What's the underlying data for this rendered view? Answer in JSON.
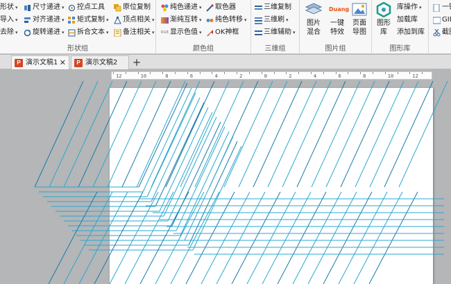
{
  "ribbon": {
    "groups": {
      "shape": {
        "label": "形状组",
        "col1": [
          "形状",
          "导入",
          "去除"
        ],
        "col2": [
          "尺寸递进",
          "对齐递进",
          "旋转递进"
        ],
        "col3": [
          "控点工具",
          "矩式复制",
          "拆合文本"
        ],
        "col4": [
          "原位复制",
          "顶点相关",
          "备注相关"
        ]
      },
      "color": {
        "label": "颜色组",
        "col1": [
          "纯色递进",
          "渐纯互转",
          "显示色值"
        ],
        "col2": [
          "取色器",
          "纯色转移",
          "OK神框"
        ]
      },
      "three_d": {
        "label": "三维组",
        "items": [
          "三维复制",
          "三维刷",
          "三维辅助"
        ]
      },
      "picture": {
        "label": "图片组",
        "big": [
          "图片混合",
          "一键特效",
          "页面导图"
        ],
        "badge": "Duang"
      },
      "shape_lib": {
        "label": "图形库",
        "big": "图形库",
        "items": [
          "库操作",
          "加载库",
          "添加到库"
        ]
      },
      "extra": {
        "items": [
          "一键",
          "GIF",
          "截图"
        ]
      }
    }
  },
  "tabs": [
    {
      "label": "演示文稿1",
      "active": true,
      "icon": "P"
    },
    {
      "label": "演示文稿2",
      "active": false,
      "icon": "P"
    }
  ],
  "ruler": {
    "labels": [
      "12",
      "10",
      "8",
      "6",
      "4",
      "2",
      "0",
      "2",
      "4",
      "6",
      "8",
      "10",
      "12"
    ]
  },
  "colors": {
    "line": "#2aa7cf",
    "line_dark": "#1779a8",
    "accent_ppt": "#d24726"
  }
}
